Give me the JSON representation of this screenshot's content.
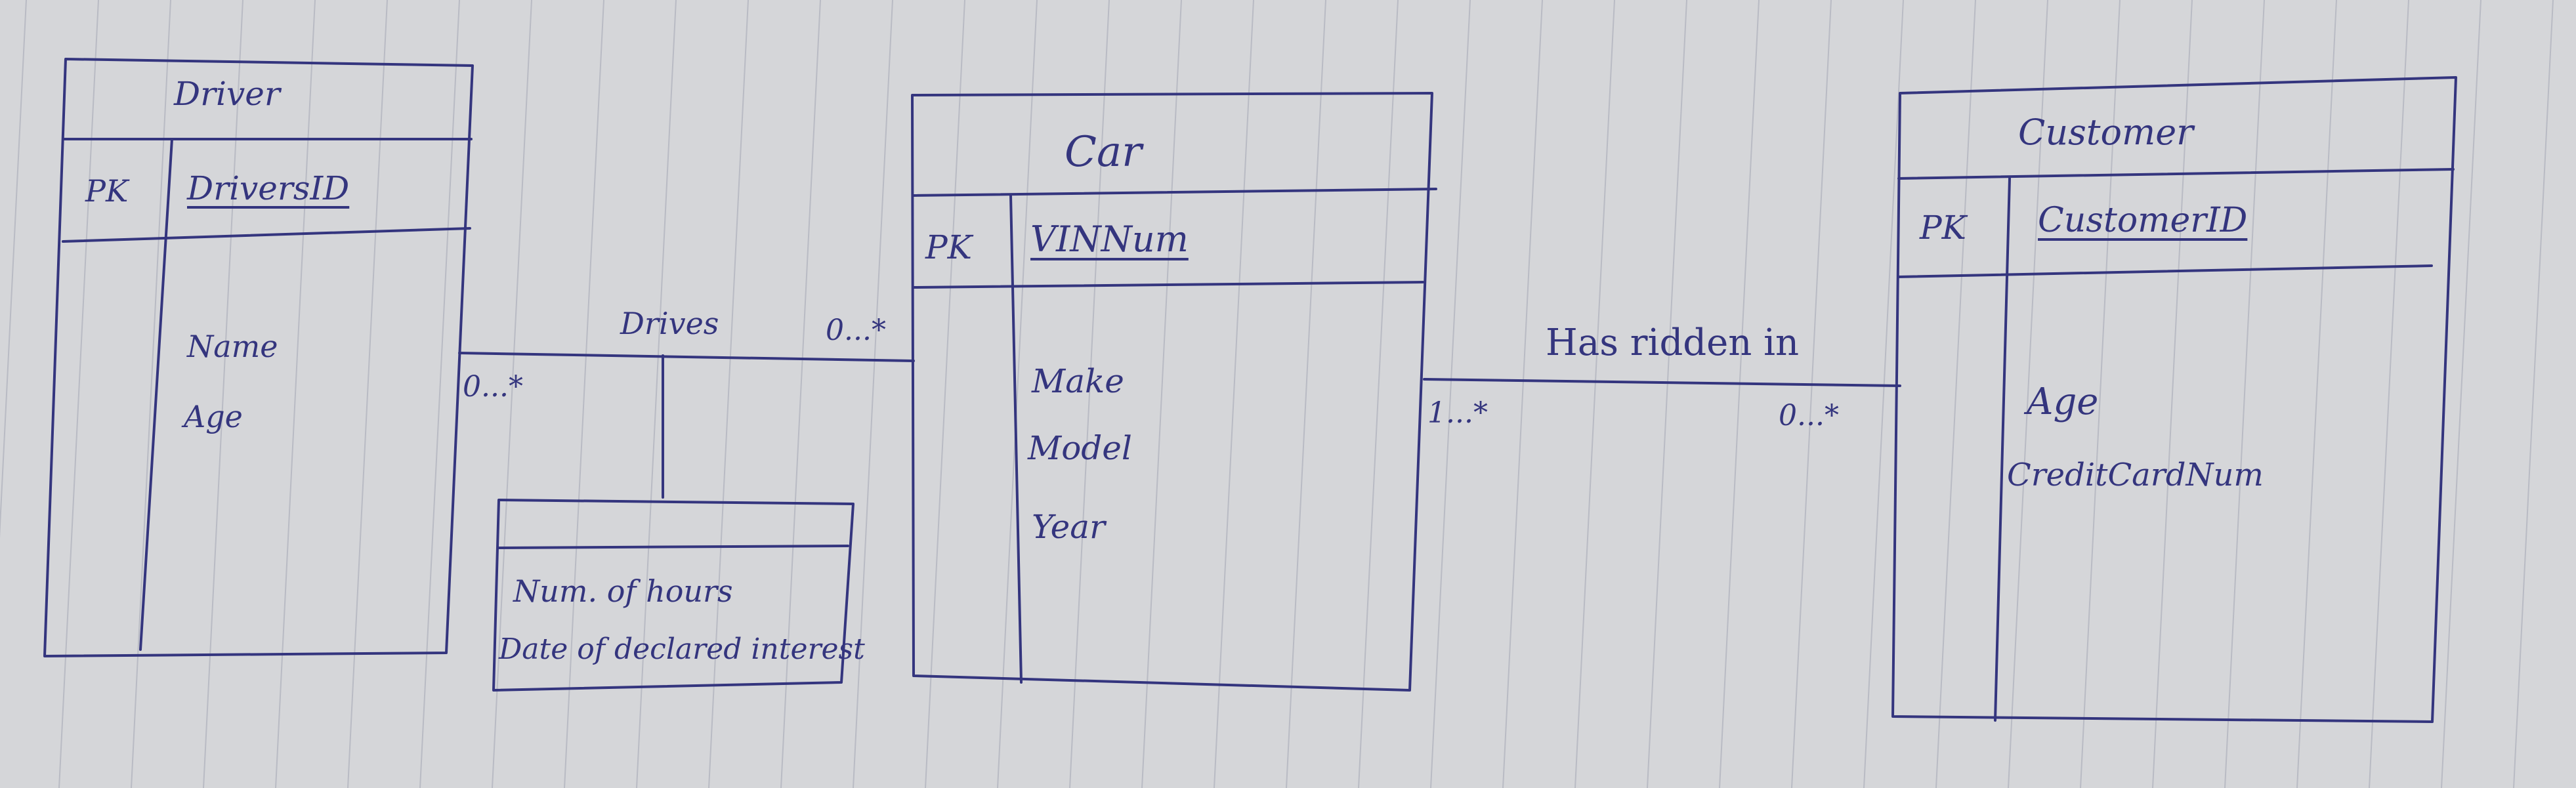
{
  "entities": {
    "driver": {
      "name": "Driver",
      "pk_label": "PK",
      "pk_field": "DriversID",
      "attributes": [
        "Name",
        "Age"
      ]
    },
    "car": {
      "name": "Car",
      "pk_label": "PK",
      "pk_field": "VINNum",
      "attributes": [
        "Make",
        "Model",
        "Year"
      ]
    },
    "customer": {
      "name": "Customer",
      "pk_label": "PK",
      "pk_field": "CustomerID",
      "attributes": [
        "Age",
        "CreditCardNum"
      ]
    }
  },
  "relationships": {
    "drives": {
      "label": "Drives",
      "left_multiplicity": "0...*",
      "right_multiplicity": "0...*",
      "association_attributes": [
        "Num. of hours",
        "Date of declared interest"
      ]
    },
    "has_ridden_in": {
      "label": "Has ridden in",
      "left_multiplicity": "1...*",
      "right_multiplicity": "0...*"
    }
  },
  "colors": {
    "ink": "#34357e",
    "paper": "#d5d6d9",
    "rule_line": "#b9bbc4"
  }
}
